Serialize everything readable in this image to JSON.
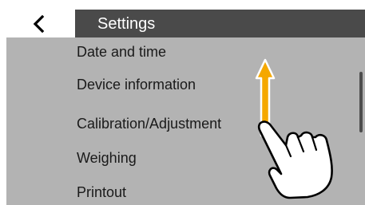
{
  "header": {
    "title": "Settings",
    "back_icon": "chevron-left-icon"
  },
  "menu": {
    "items": [
      {
        "label": "Date and time"
      },
      {
        "label": "Device information"
      },
      {
        "label": "Calibration/Adjustment"
      },
      {
        "label": "Weighing"
      },
      {
        "label": "Printout"
      }
    ]
  },
  "gesture": {
    "icons": [
      "swipe-up-arrow-icon",
      "hand-pointer-icon"
    ],
    "arrow_color": "#f5a800",
    "direction": "up"
  },
  "colors": {
    "title_bar": "#4a4a4a",
    "list_background": "#b3b3b3",
    "text": "#1a1a1a"
  }
}
